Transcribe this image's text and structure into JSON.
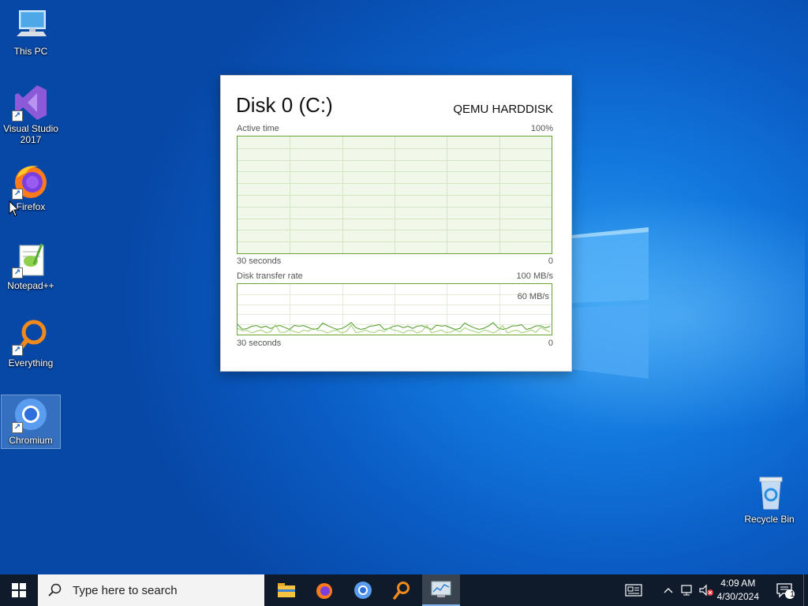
{
  "desktop": {
    "icons": [
      {
        "label": "This PC"
      },
      {
        "label": "Visual Studio 2017"
      },
      {
        "label": "Firefox"
      },
      {
        "label": "Notepad++"
      },
      {
        "label": "Everything"
      },
      {
        "label": "Chromium"
      },
      {
        "label": "Recycle Bin"
      }
    ]
  },
  "disk_widget": {
    "title": "Disk 0 (C:)",
    "model": "QEMU HARDDISK",
    "active_time": {
      "label": "Active time",
      "max_label": "100%",
      "time_label": "30 seconds",
      "min_label": "0"
    },
    "transfer_rate": {
      "label": "Disk transfer rate",
      "max_label": "100 MB/s",
      "mid_label": "60 MB/s",
      "time_label": "30 seconds",
      "min_label": "0"
    }
  },
  "taskbar": {
    "search_placeholder": "Type here to search",
    "pinned": [
      "file-explorer-icon",
      "firefox-icon",
      "chromium-icon",
      "everything-icon",
      "resource-monitor-icon"
    ],
    "time": "4:09 AM",
    "date": "4/30/2024",
    "notification_count": "1"
  },
  "colors": {
    "graph_border": "#6aa534",
    "graph_fill": "#f1f7e9",
    "taskbar": "#0f1a2a"
  }
}
